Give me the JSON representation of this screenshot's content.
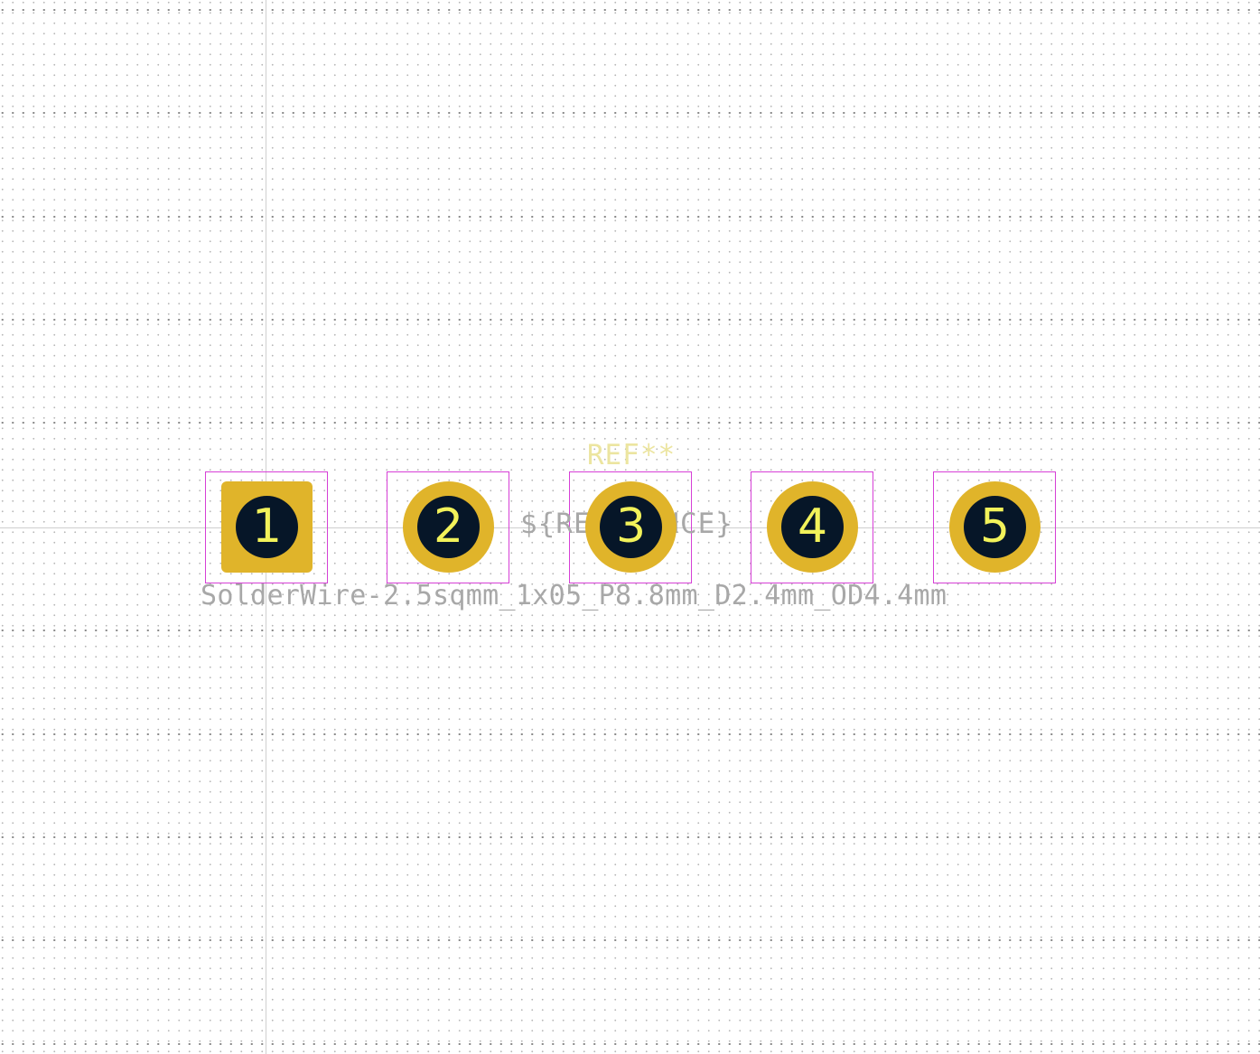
{
  "editor": {
    "reference_text": "REF**",
    "value_text": "${REFERENCE}",
    "footprint_name": "SolderWire-2.5sqmm_1x05_P8.8mm_D2.4mm_OD4.4mm"
  },
  "pads": [
    {
      "number": "1",
      "shape": "square"
    },
    {
      "number": "2",
      "shape": "round"
    },
    {
      "number": "3",
      "shape": "round"
    },
    {
      "number": "4",
      "shape": "round"
    },
    {
      "number": "5",
      "shape": "round"
    }
  ],
  "colors": {
    "pad_copper": "#e0b42a",
    "drill_hole": "#061628",
    "pad_number": "#f2f25a",
    "courtyard": "#d63fd6",
    "reference": "#ece5a0",
    "fab_text": "#a8a8a8",
    "background": "#ffffff"
  }
}
